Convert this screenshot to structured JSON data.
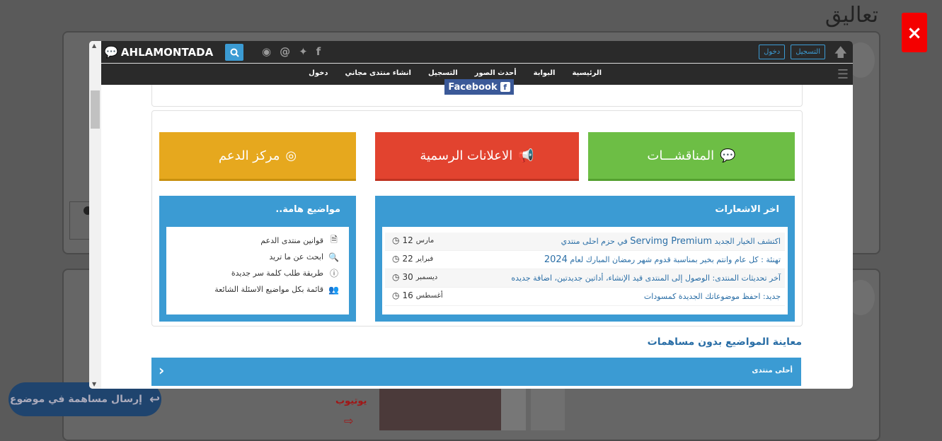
{
  "background": {
    "page_title": "تعاليق",
    "youtube_label": "يوتيوب",
    "reply_button": "إرسال مساهمة في موضوع"
  },
  "close_label": "×",
  "topbar": {
    "brand": "AHLAMONTADA",
    "auth": {
      "register": "التسجيل",
      "login": "دخول"
    }
  },
  "nav": {
    "items": [
      "الرئيسية",
      "البوابة",
      "أحدث الصور",
      "التسجيل",
      "انشاء منتدى مجاني",
      "دخول"
    ]
  },
  "facebook": {
    "label": "Facebook"
  },
  "tiles": {
    "support": "مركز الدعم",
    "announcements": "الاعلانات الرسمية",
    "discussions": "المناقشـــات"
  },
  "important": {
    "title": "مواضيع هامة..",
    "items": [
      {
        "label": "قوانين منتدى الدعم",
        "icon": "document-icon"
      },
      {
        "label": "ابحث عن ما تريد",
        "icon": "search-icon"
      },
      {
        "label": "طريقة طلب كلمة سر جديدة",
        "icon": "info-icon"
      },
      {
        "label": "قائمة بكل مواضيع الاسئلة الشائعة",
        "icon": "users-icon"
      }
    ]
  },
  "announcements": {
    "title": "اخر الاشعارات",
    "items": [
      {
        "pre": "اكتشف الخيار الجديد ",
        "big": "Servimg Premium",
        "post": " في حزم احلى منتدي",
        "day": "12",
        "month": "مارس"
      },
      {
        "pre": "تهنئة : كل عام وانتم بخير بمناسبة قدوم شهر رمضان المبارك لعام ",
        "big": "2024",
        "post": "",
        "day": "22",
        "month": "فبراير"
      },
      {
        "pre": "آخر تحديثات المنتدى: الوصول إلى المنتدى قيد الإنشاء، أداتين جديدتين، اضافة جديده",
        "big": "",
        "post": "",
        "day": "30",
        "month": "ديسمبر"
      },
      {
        "pre": "جديد: احفظ موضوعاتك الجديدة كمسودات",
        "big": "",
        "post": "",
        "day": "16",
        "month": "أغسطس"
      }
    ]
  },
  "unanswered": {
    "title": "معاينة المواضيع بدون مساهمات",
    "forum_name": "أحلى منتدى"
  }
}
